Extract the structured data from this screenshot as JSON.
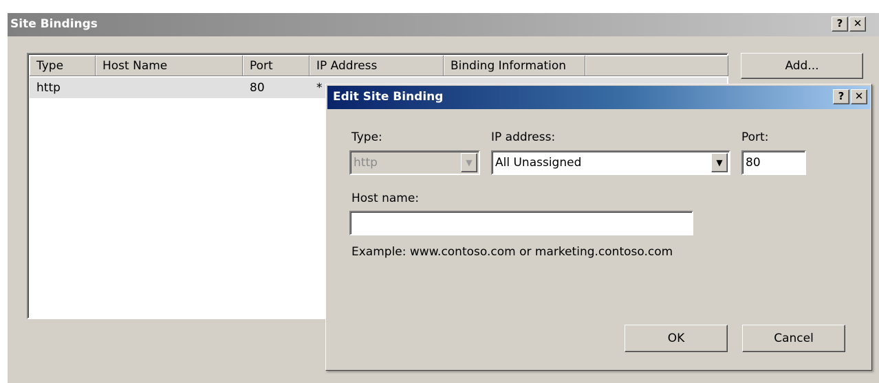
{
  "site_bindings": {
    "title": "Site Bindings",
    "help_label": "?",
    "close_label": "✕",
    "columns": [
      "Type",
      "Host Name",
      "Port",
      "IP Address",
      "Binding Information"
    ],
    "rows": [
      {
        "type": "http",
        "host_name": "",
        "port": "80",
        "ip_address": "*",
        "binding_information": ""
      }
    ],
    "add_label": "Add..."
  },
  "edit_dialog": {
    "title": "Edit Site Binding",
    "help_label": "?",
    "close_label": "✕",
    "type_label": "Type:",
    "type_value": "http",
    "ip_label": "IP address:",
    "ip_value": "All Unassigned",
    "port_label": "Port:",
    "port_value": "80",
    "host_label": "Host name:",
    "host_value": "",
    "example_text": "Example: www.contoso.com or marketing.contoso.com",
    "ok_label": "OK",
    "cancel_label": "Cancel"
  },
  "icons": {
    "dropdown": "chevron-down-icon",
    "help": "help-icon",
    "close": "close-icon"
  },
  "colors": {
    "dialog_face": "#d4d0c8",
    "active_title_start": "#0a246a",
    "active_title_end": "#a6caf0",
    "inactive_title_start": "#808080",
    "inactive_title_end": "#c9c9c9"
  }
}
